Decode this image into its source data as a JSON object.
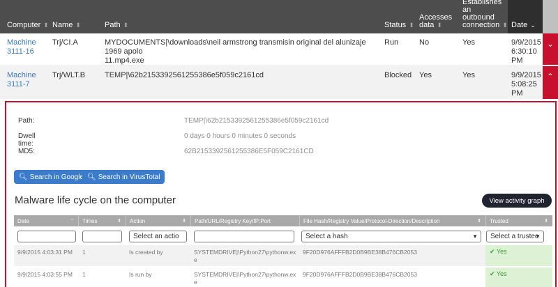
{
  "top_table": {
    "headers": {
      "computer": "Computer",
      "name": "Name",
      "path": "Path",
      "status": "Status",
      "accesses_line1": "Accesses",
      "accesses_line2": "data",
      "outbound_line1": "Establishes",
      "outbound_line2": "an",
      "outbound_line3": "outbound",
      "outbound_line4": "connection",
      "date": "Date"
    },
    "rows": [
      {
        "computer_line1": "Machine",
        "computer_line2": "3111-16",
        "name": "Trj/CI.A",
        "path_line1": "MYDOCUMENTS|\\downloads\\neil armstrong transmisin original del alunizaje 1969 apolo",
        "path_line2": "11.mp4.exe",
        "status": "Run",
        "accesses": "No",
        "outbound": "Yes",
        "date_line1": "9/9/2015",
        "date_line2": "6:30:10",
        "date_line3": "PM"
      },
      {
        "computer_line1": "Machine",
        "computer_line2": "3111-7",
        "name": "Trj/WLT.B",
        "path_line1": "TEMP|\\62b2153392561255386e5f059c2161cd",
        "path_line2": "",
        "status": "Blocked",
        "accesses": "Yes",
        "outbound": "Yes",
        "date_line1": "9/9/2015",
        "date_line2": "5:08:25",
        "date_line3": "PM"
      }
    ]
  },
  "detail": {
    "path_label": "Path:",
    "path_value": "TEMP|\\62b2153392561255386e5f059c2161cd",
    "dwell_label": "Dwell time:",
    "dwell_value": "0 days 0 hours 0 minutes 0 seconds",
    "md5_label": "MD5:",
    "md5_value": "62B2153392561255386E5F059C2161CD",
    "google_button": "Search in Google",
    "virustotal_button": "Search in VirusTotal",
    "section_title": "Malware life cycle on the computer",
    "activity_button": "View activity graph"
  },
  "lifecycle": {
    "headers": {
      "date": "Date",
      "times": "Times",
      "action": "Action",
      "path": "Path/URL/Registry Key/IP:Port",
      "hash": "File Hash/Registry Value/Protocol-Direction/Description",
      "trusted": "Trusted"
    },
    "filters": {
      "action": "Select an actio",
      "hash": "Select a hash",
      "trusted": "Select a trustec"
    },
    "rows": [
      {
        "date": "9/9/2015 4:03:31 PM",
        "times": "1",
        "action": "Is created by",
        "path_line1": "SYSTEMDRIVE|\\Python27\\pythonw.ex",
        "path_line2": "e",
        "hash": "9F20D976AFFFB2D0B9BE38B476CB2053",
        "trusted": "Yes"
      },
      {
        "date": "9/9/2015 4:03:55 PM",
        "times": "1",
        "action": "Is run by",
        "path_line1": "SYSTEMDRIVE|\\Python27\\pythonw.ex",
        "path_line2": "e",
        "hash": "9F20D976AFFFB2D0B9BE38B476CB2053",
        "trusted": "Yes"
      }
    ]
  },
  "colors": {
    "header_bg": "#4d4d4d",
    "accent_red": "#c8102e",
    "link_blue": "#3a78c3",
    "button_blue": "#3a7ccb",
    "trusted_green": "#3c9a2e"
  },
  "icons": {
    "sort": "sort-arrows-icon",
    "expand": "chevron-down-icon",
    "collapse": "chevron-up-icon",
    "search": "search-icon",
    "check": "check-icon"
  }
}
